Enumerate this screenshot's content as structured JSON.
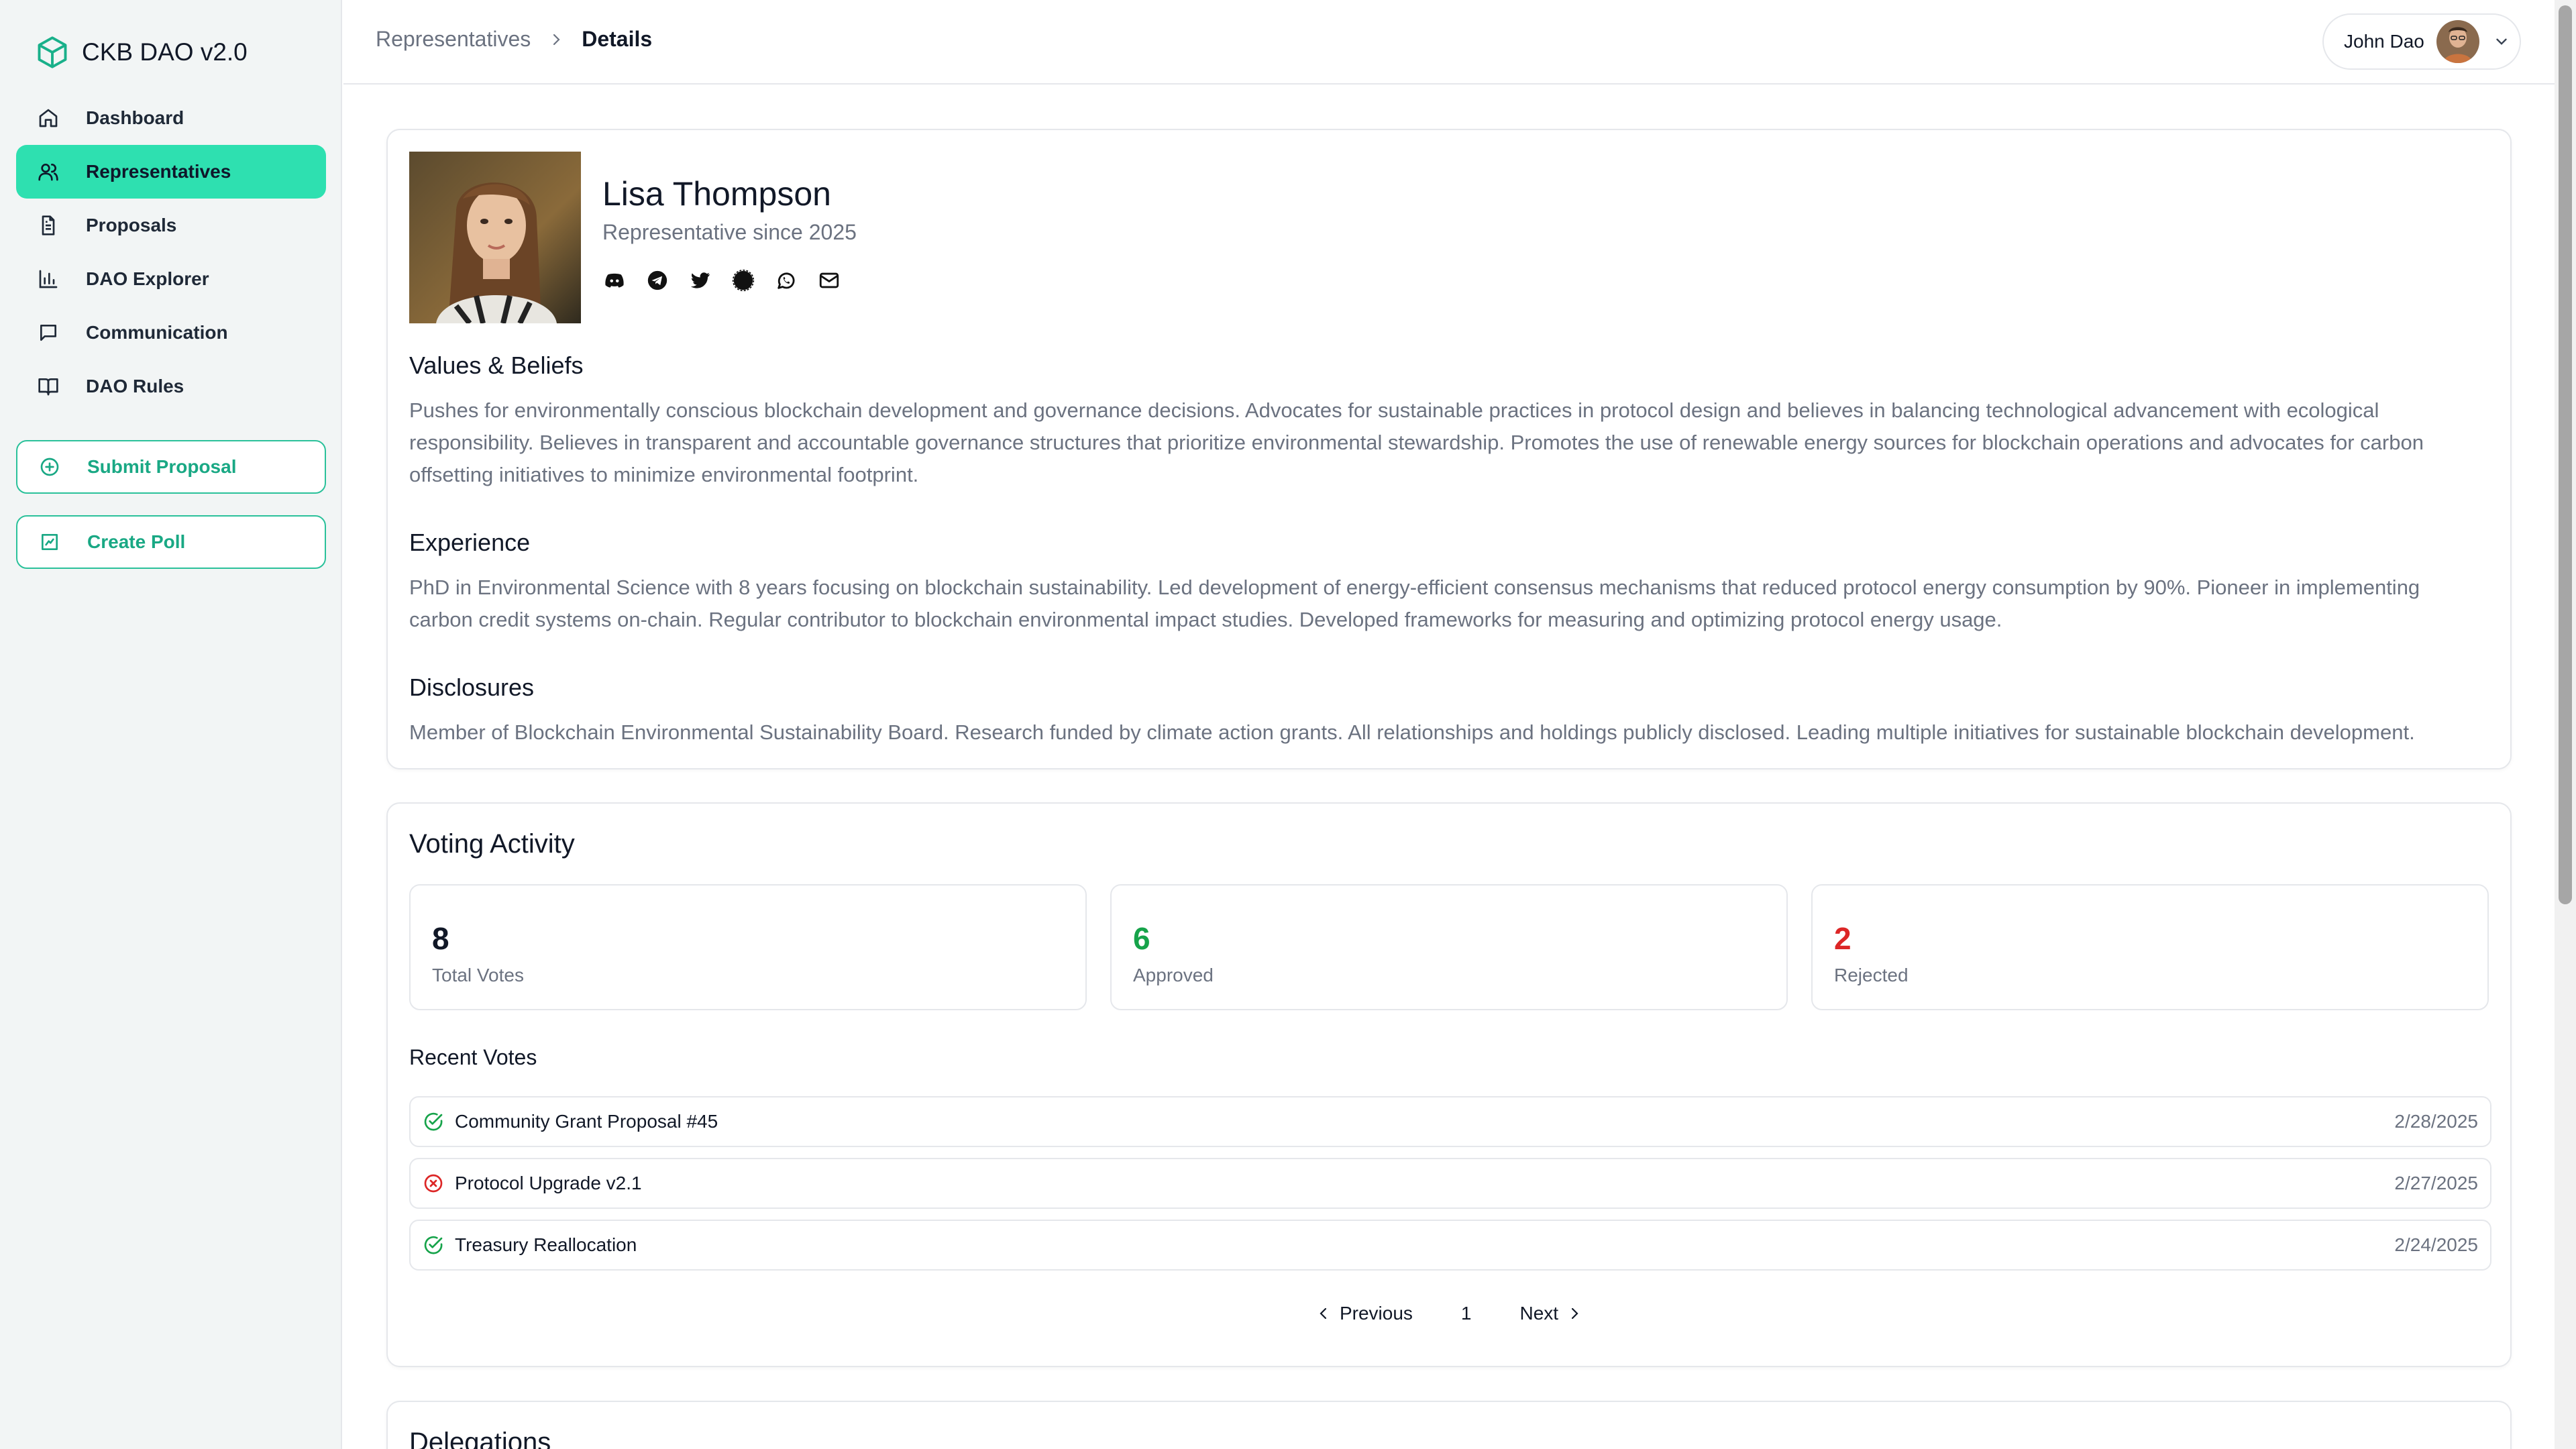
{
  "app": {
    "title": "CKB DAO v2.0"
  },
  "sidebar": {
    "items": [
      {
        "label": "Dashboard",
        "icon": "home-icon"
      },
      {
        "label": "Representatives",
        "icon": "users-icon",
        "active": true
      },
      {
        "label": "Proposals",
        "icon": "file-text-icon"
      },
      {
        "label": "DAO Explorer",
        "icon": "bar-chart-icon"
      },
      {
        "label": "Communication",
        "icon": "message-square-icon"
      },
      {
        "label": "DAO Rules",
        "icon": "book-open-icon"
      }
    ],
    "submit_proposal": "Submit Proposal",
    "create_poll": "Create Poll"
  },
  "header": {
    "breadcrumb_parent": "Representatives",
    "breadcrumb_current": "Details",
    "user_name": "John Dao"
  },
  "profile": {
    "name": "Lisa Thompson",
    "since": "Representative since 2025",
    "socials": [
      "discord-icon",
      "telegram-icon",
      "twitter-icon",
      "signal-icon",
      "whatsapp-icon",
      "mail-icon"
    ],
    "values_title": "Values & Beliefs",
    "values_text": "Pushes for environmentally conscious blockchain development and governance decisions. Advocates for sustainable practices in protocol design and believes in balancing technological advancement with ecological responsibility. Believes in transparent and accountable governance structures that prioritize environmental stewardship. Promotes the use of renewable energy sources for blockchain operations and advocates for carbon offsetting initiatives to minimize environmental footprint.",
    "experience_title": "Experience",
    "experience_text": "PhD in Environmental Science with 8 years focusing on blockchain sustainability. Led development of energy-efficient consensus mechanisms that reduced protocol energy consumption by 90%. Pioneer in implementing carbon credit systems on-chain. Regular contributor to blockchain environmental impact studies. Developed frameworks for measuring and optimizing protocol energy usage.",
    "disclosures_title": "Disclosures",
    "disclosures_text": "Member of Blockchain Environmental Sustainability Board. Research funded by climate action grants. All relationships and holdings publicly disclosed. Leading multiple initiatives for sustainable blockchain development."
  },
  "voting": {
    "title": "Voting Activity",
    "stats": [
      {
        "value": "8",
        "label": "Total Votes",
        "color": "#111827"
      },
      {
        "value": "6",
        "label": "Approved",
        "color": "#16a34a"
      },
      {
        "value": "2",
        "label": "Rejected",
        "color": "#dc2626"
      }
    ],
    "recent_title": "Recent Votes",
    "recent": [
      {
        "title": "Community Grant Proposal #45",
        "date": "2/28/2025",
        "status": "approved"
      },
      {
        "title": "Protocol Upgrade v2.1",
        "date": "2/27/2025",
        "status": "rejected"
      },
      {
        "title": "Treasury Reallocation",
        "date": "2/24/2025",
        "status": "approved"
      }
    ],
    "pagination": {
      "previous": "Previous",
      "page": "1",
      "next": "Next"
    }
  },
  "delegations": {
    "title": "Delegations"
  },
  "colors": {
    "accent": "#2ee0b0",
    "accent_dark": "#19a884",
    "approved": "#16a34a",
    "rejected": "#dc2626"
  }
}
